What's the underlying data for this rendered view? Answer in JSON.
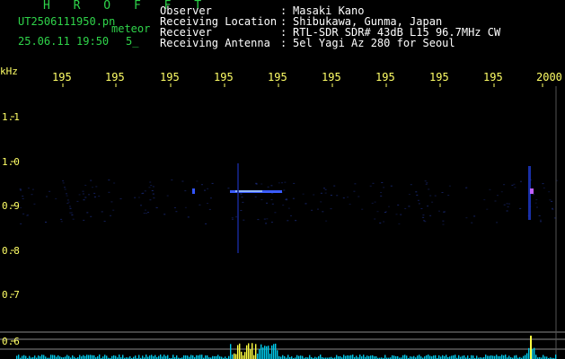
{
  "header": {
    "program": "H R O F F T",
    "filename": "UT2506111950.pn",
    "mode": "meteor",
    "datetime": "25.06.11 19:50",
    "count": "5_"
  },
  "info": [
    {
      "label": "Observer",
      "sep": ":",
      "value": "Masaki Kano"
    },
    {
      "label": "Receiving Location",
      "sep": ":",
      "value": "Shibukawa, Gunma, Japan"
    },
    {
      "label": "Receiver",
      "sep": ":",
      "value": "RTL-SDR SDR# 43dB L15 96.7MHz CW"
    },
    {
      "label": "Receiving Antenna",
      "sep": ":",
      "value": "5el Yagi Az 280 for Seoul"
    }
  ],
  "axis": {
    "y_unit": "kHz",
    "x_ticks": [
      "195",
      "195",
      "195",
      "195",
      "195",
      "195",
      "195",
      "195",
      "195",
      "2000"
    ],
    "y_ticks": [
      "1.1",
      "1.0",
      "0.9",
      "0.8",
      "0.7",
      "0.6"
    ]
  },
  "colors": {
    "background": "#000000",
    "header_text": "#2fd44a",
    "info_text": "#ffffff",
    "tick_text": "#ffff66",
    "signal_blue": "#3a5cff",
    "spectrum_cyan": "#00c8e8",
    "spectrum_yellow": "#ffff40"
  }
}
